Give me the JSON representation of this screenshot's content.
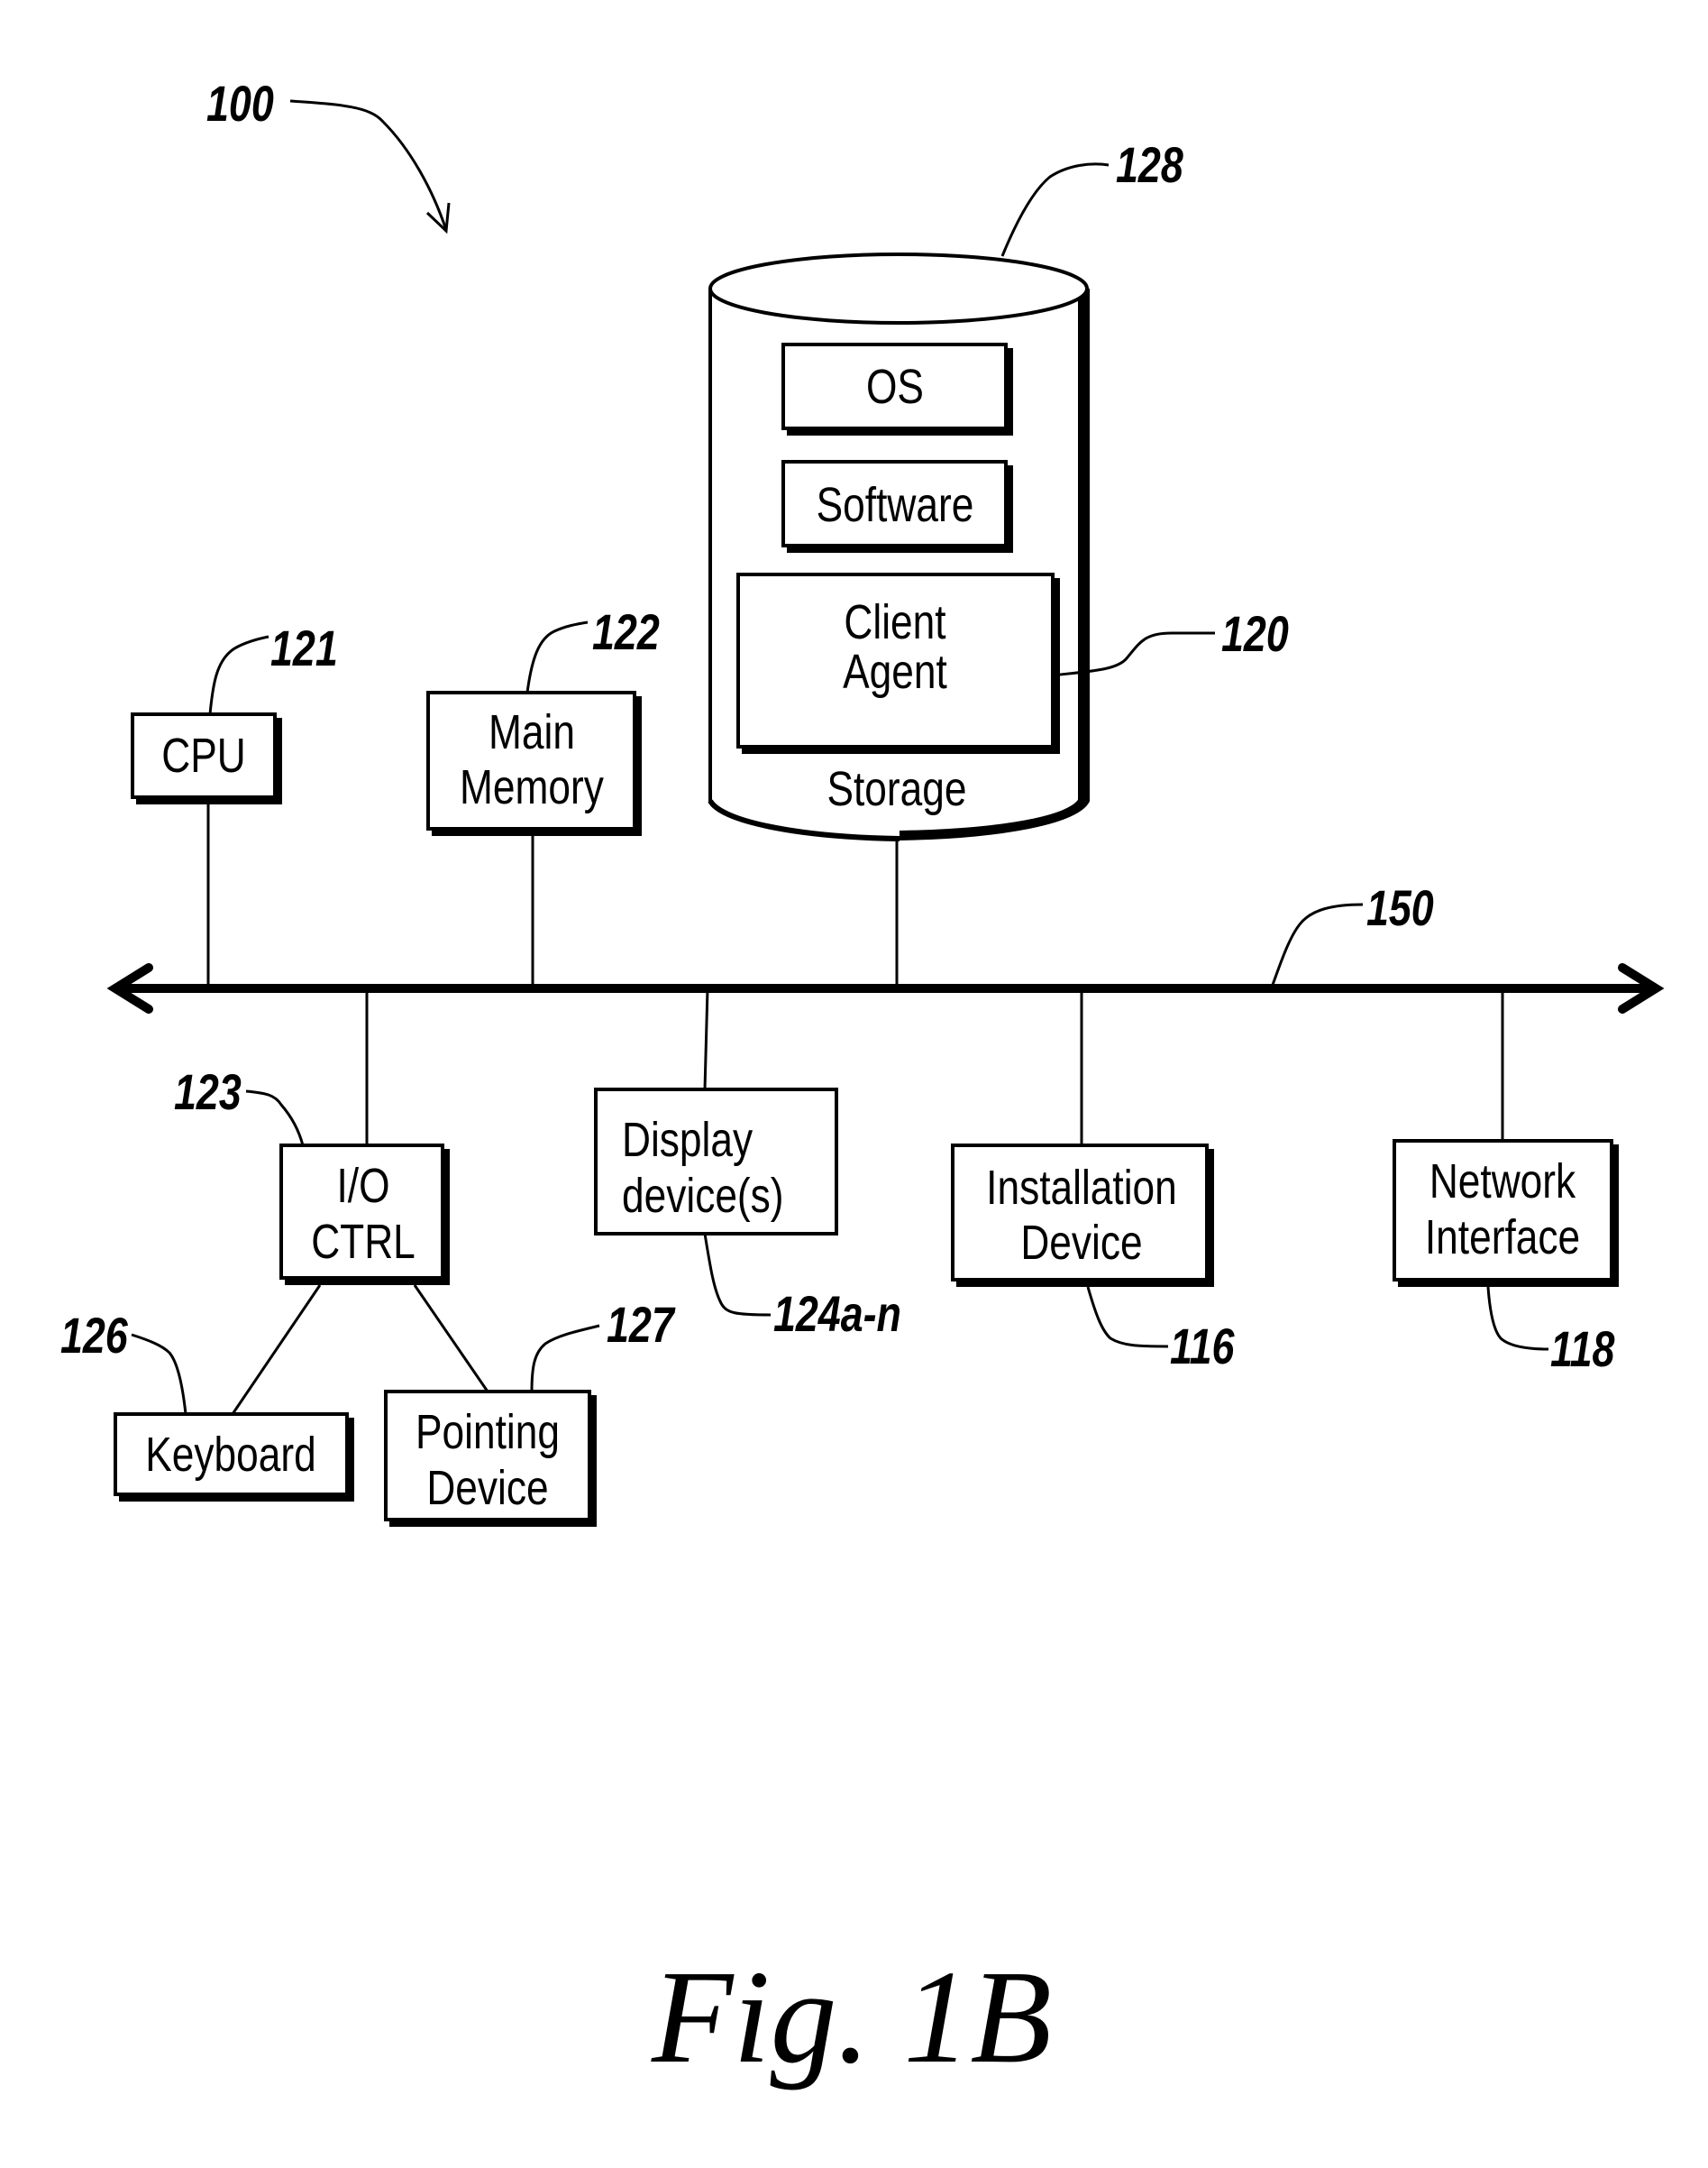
{
  "figure": {
    "caption": "Fig. 1B",
    "reference": "100"
  },
  "bus": {
    "reference": "150"
  },
  "components": {
    "cpu": {
      "label": "CPU",
      "reference": "121"
    },
    "main_memory": {
      "label_lines": [
        "Main",
        "Memory"
      ],
      "reference": "122"
    },
    "io_ctrl": {
      "label_lines": [
        "I/O",
        "CTRL"
      ],
      "reference": "123"
    },
    "display": {
      "label_lines": [
        "Display",
        "device(s)"
      ],
      "reference": "124a-n"
    },
    "installation": {
      "label_lines": [
        "Installation",
        "Device"
      ],
      "reference": "116"
    },
    "network": {
      "label_lines": [
        "Network",
        "Interface"
      ],
      "reference": "118"
    },
    "keyboard": {
      "label": "Keyboard",
      "reference": "126"
    },
    "pointing": {
      "label_lines": [
        "Pointing",
        "Device"
      ],
      "reference": "127"
    },
    "storage": {
      "label": "Storage",
      "reference": "128",
      "contents": {
        "os": {
          "label": "OS"
        },
        "software": {
          "label": "Software"
        },
        "client_agent": {
          "label_lines": [
            "Client",
            "Agent"
          ],
          "reference": "120"
        }
      }
    }
  }
}
